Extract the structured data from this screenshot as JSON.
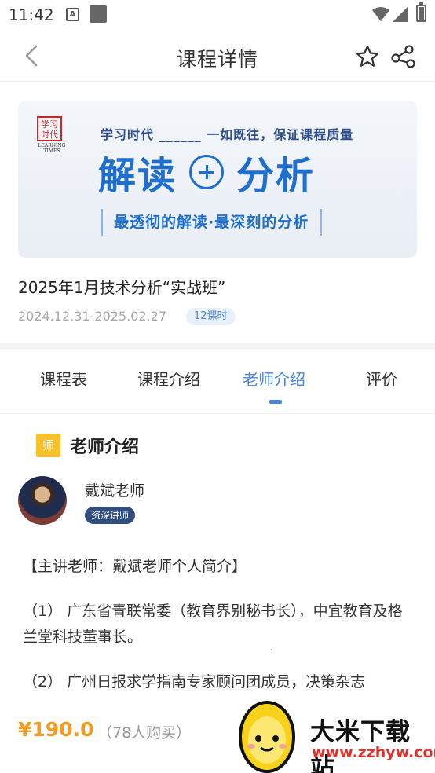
{
  "status_bar": {
    "time": "11:42",
    "notification_letter": "A"
  },
  "nav": {
    "title": "课程详情"
  },
  "banner": {
    "logo_text": "学习时代",
    "logo_sub": "LEARNING TIMES",
    "tagline": "学习时代 ______ 一如既往，保证课程质量",
    "headline_left": "解读",
    "headline_right": "分析",
    "subline": "最透彻的解读·最深刻的分析"
  },
  "course": {
    "title": "2025年1月技术分析“实战班”",
    "date_range": "2024.12.31-2025.02.27",
    "hours": "12课时"
  },
  "tabs": [
    {
      "label": "课程表"
    },
    {
      "label": "课程介绍"
    },
    {
      "label": "老师介绍"
    },
    {
      "label": "评价"
    }
  ],
  "active_tab": "老师介绍",
  "teacher": {
    "badge": "师",
    "heading": "老师介绍",
    "name": "戴斌老师",
    "tag": "资深讲师",
    "intro_title": "【主讲老师：戴斌老师个人简介】",
    "intro_items": [
      "（1） 广东省青联常委（教育界别秘书长），中宜教育及格兰堂科技董事长。",
      "（2） 广州日报求学指南专家顾问团成员，决策杂志"
    ]
  },
  "purchase": {
    "price": "¥190.0",
    "buyers": "（78人购买）"
  },
  "watermark": {
    "title": "大米下载站",
    "url": "www.zzhyw.com"
  },
  "colors": {
    "accent": "#4a86d6",
    "price": "#f39a21",
    "badge": "#f7c12b",
    "tag_bg": "#2f4d7e"
  }
}
